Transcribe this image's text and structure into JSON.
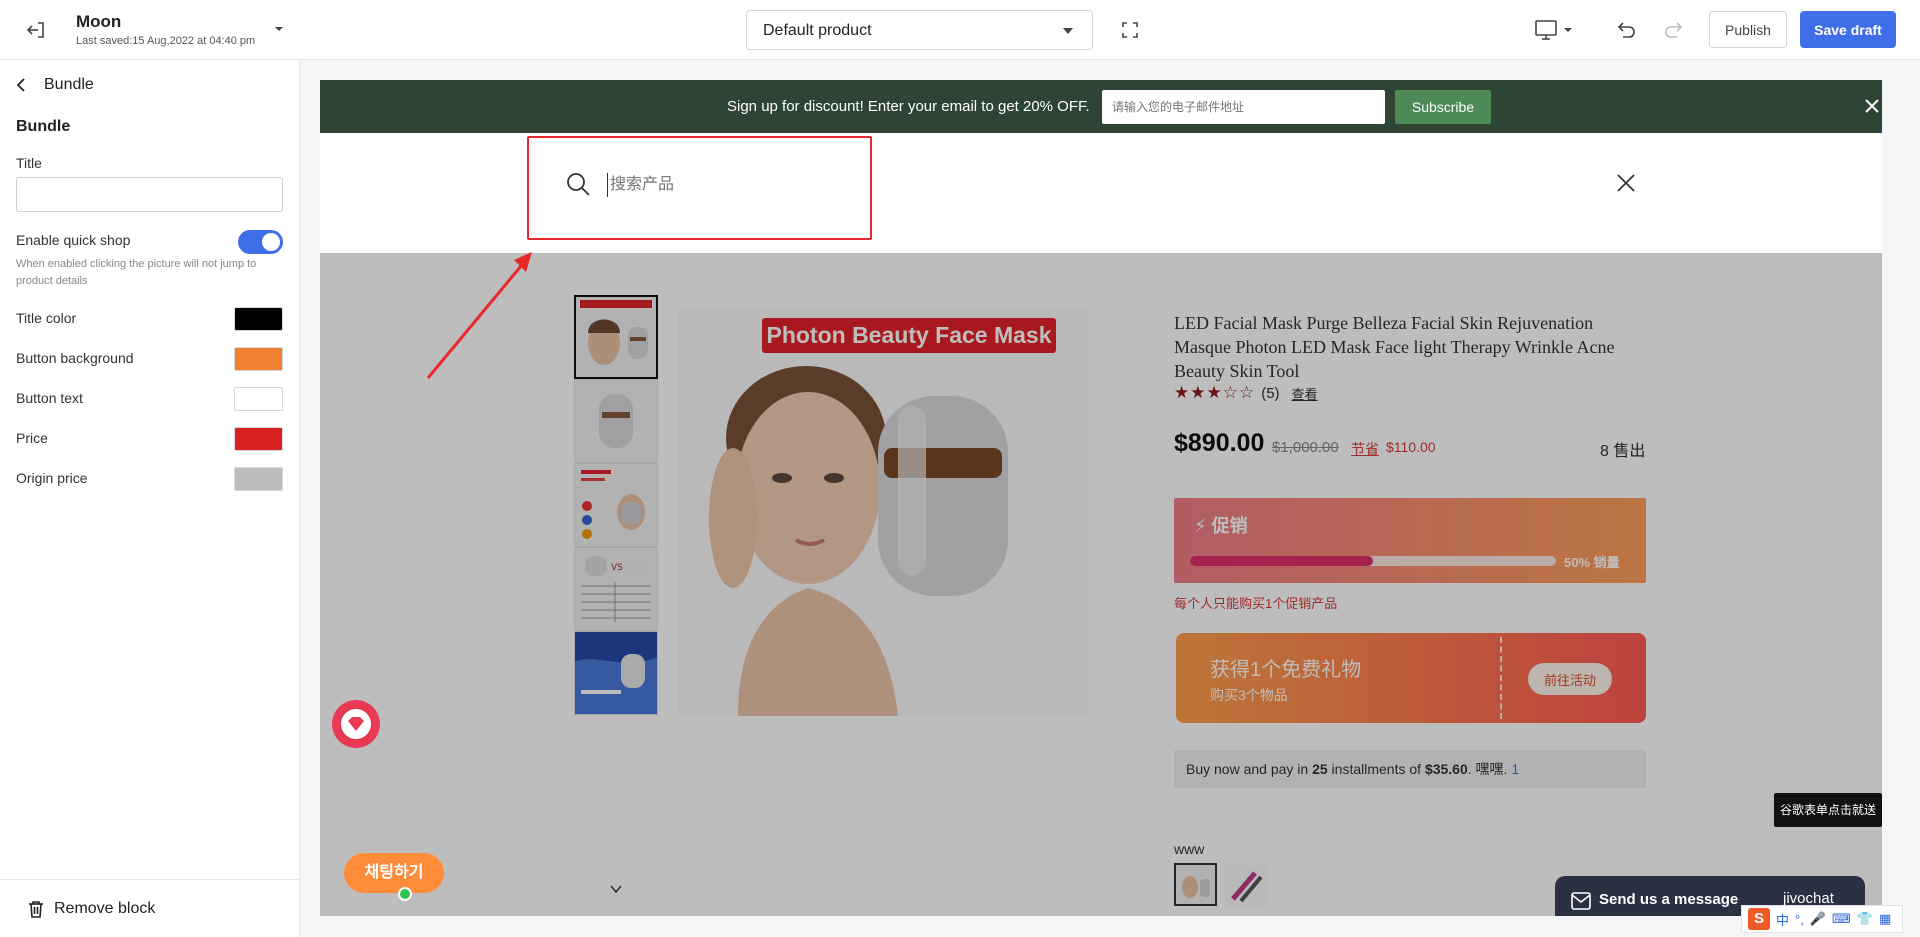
{
  "topbar": {
    "site_name": "Moon",
    "last_saved": "Last saved:15 Aug,2022 at 04:40 pm",
    "template_select": "Default product",
    "publish_label": "Publish",
    "save_label": "Save draft"
  },
  "sidebar": {
    "back_label": "Bundle",
    "heading": "Bundle",
    "title_label": "Title",
    "title_value": "",
    "quick_shop_label": "Enable quick shop",
    "quick_shop_enabled": true,
    "quick_shop_help": "When enabled clicking the picture will not jump to product details",
    "colors": [
      {
        "label": "Title color",
        "value": "#000000"
      },
      {
        "label": "Button background",
        "value": "#f0802f"
      },
      {
        "label": "Button text",
        "value": "#ffffff"
      },
      {
        "label": "Price",
        "value": "#d92121"
      },
      {
        "label": "Origin price",
        "value": "#bdbdbd"
      }
    ],
    "remove_label": "Remove block"
  },
  "preview": {
    "promo_text": "Sign up for discount! Enter your email to get 20% OFF.",
    "promo_email_placeholder": "请输入您的电子邮件地址",
    "promo_subscribe": "Subscribe",
    "search_placeholder": "搜索产品",
    "main_image_banner": "Photon Beauty Face Mask",
    "product_title": "LED Facial Mask Purge Belleza Facial Skin Rejuvenation Masque Photon LED Mask Face light Therapy Wrinkle Acne Beauty Skin Tool",
    "rating_stars": 3,
    "rating_stars_text": "★★★☆☆",
    "rating_count": "(5)",
    "rating_view": "查看",
    "price": "$890.00",
    "original_price": "$1,000.00",
    "save_label": "节省",
    "save_amount": "$110.00",
    "sold": "8 售出",
    "flash_label": "促销",
    "flash_progress": 0.5,
    "flash_progress_text": "50% 销量",
    "limit_note": "每个人只能购买1个促销产品",
    "gift_title": "获得1个免费礼物",
    "gift_sub": "购买3个物品",
    "gift_button": "前往活动",
    "installments_prefix": "Buy now and pay in ",
    "installments_count": "25",
    "installments_mid": " installments of ",
    "installments_amount": "$35.60",
    "installments_suffix": ". 嘿嘿. ",
    "installments_link": "1",
    "variant_label": "www",
    "chat_korean": "채팅하기",
    "tooltip": "谷歌表单点击就送",
    "jivo_text": "Send us a message",
    "jivo_brand": "jivochat"
  },
  "ime": {
    "lang": "中",
    "punct": "°,"
  }
}
